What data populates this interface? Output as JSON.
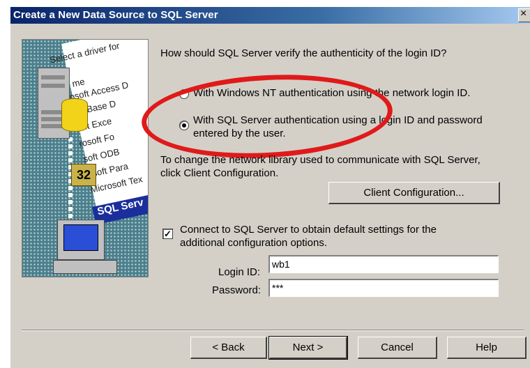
{
  "window": {
    "title": "Create a New Data Source to SQL Server",
    "close_glyph": "×"
  },
  "illustration": {
    "label_select": "Select a driver for",
    "list_lines": [
      "me",
      "rosoft Access D",
      "oft dBase D",
      "soft Exce",
      "rosoft Fo",
      "soft ODB",
      "osoft Para",
      "Microsoft Tex"
    ],
    "selected": "SQL Serv",
    "chip_text": "32"
  },
  "question": "How should SQL Server verify the authenticity of the login ID?",
  "auth_options": [
    {
      "label": "With Windows NT authentication using the network login ID.",
      "selected": false
    },
    {
      "label_line1": "With SQL Server authentication using a login ID and password",
      "label_line2": "entered by the user.",
      "selected": true
    }
  ],
  "network_text_line1": "To change the network library used to communicate with SQL Server,",
  "network_text_line2": "click Client Configuration.",
  "client_config_button": "Client Configuration...",
  "connect_checkbox": {
    "checked": true,
    "check_glyph": "✓",
    "label_line1": "Connect to SQL Server to obtain default settings for the",
    "label_line2": "additional configuration options."
  },
  "login": {
    "label": "Login ID:",
    "value": "wb1"
  },
  "password": {
    "label": "Password:",
    "value": "***"
  },
  "buttons": {
    "back": "< Back",
    "next": "Next >",
    "cancel": "Cancel",
    "help": "Help"
  },
  "colors": {
    "annotation": "#e01a1a",
    "title_start": "#0a246a"
  }
}
